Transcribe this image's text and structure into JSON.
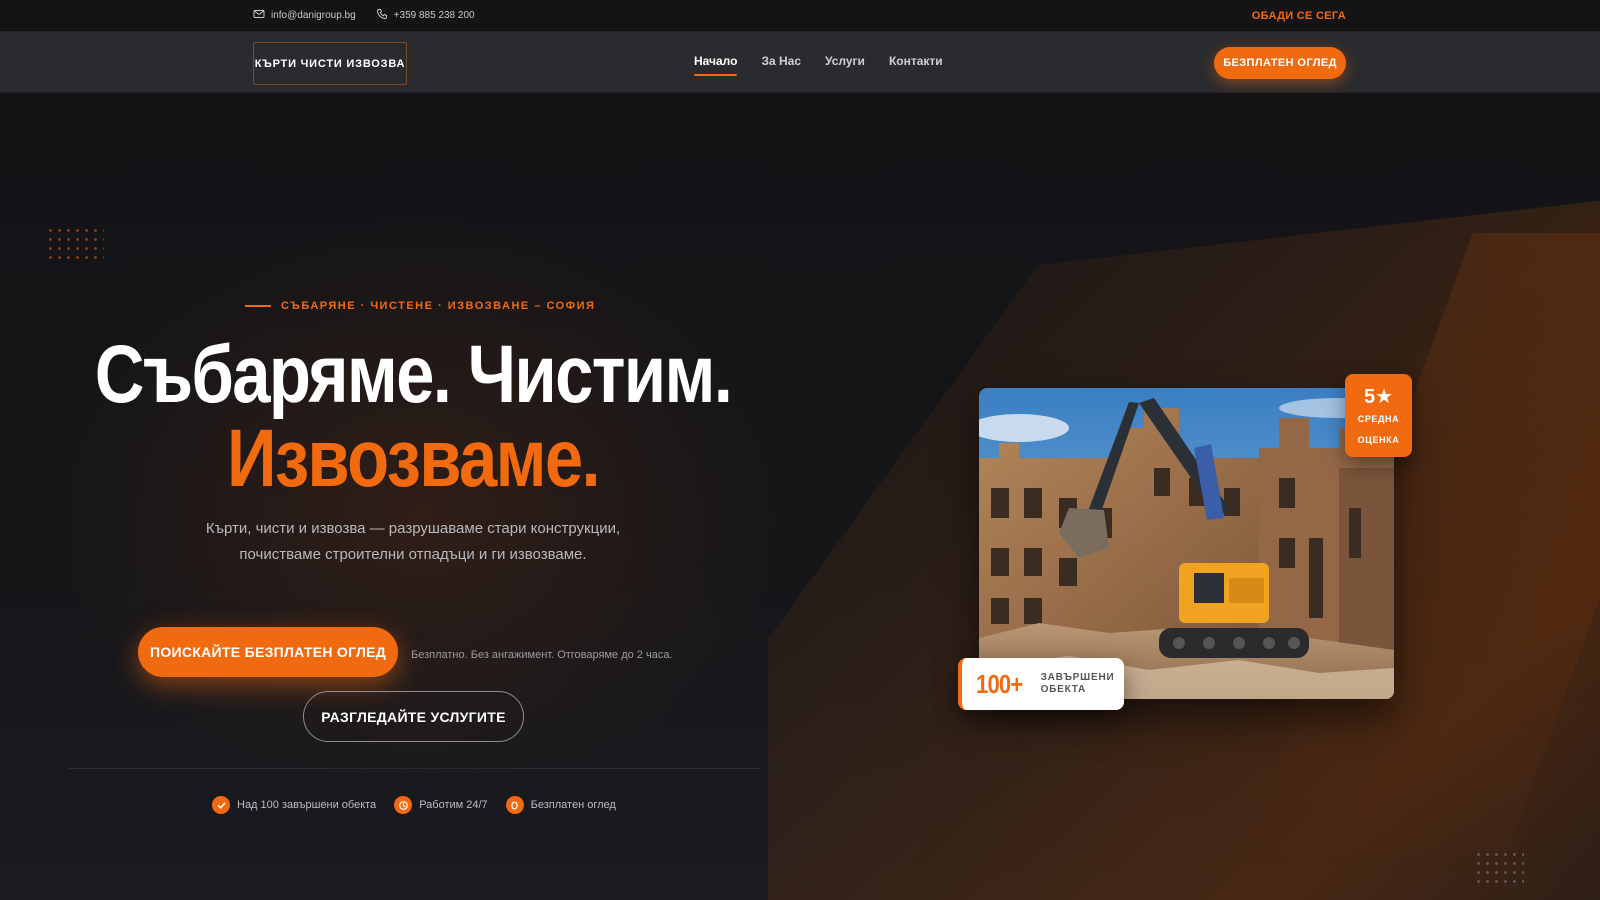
{
  "topbar": {
    "email": "info@danigroup.bg",
    "phone": "+359 885 238 200",
    "call_now": "ОБАДИ СЕ СЕГА"
  },
  "nav": {
    "logo": "КЪРТИ ЧИСТИ ИЗВОЗВА",
    "links": [
      "Начало",
      "За Нас",
      "Услуги",
      "Контакти"
    ],
    "active": "Начало",
    "cta": "БЕЗПЛАТЕН ОГЛЕД"
  },
  "hero": {
    "eyebrow": "СЪБАРЯНЕ · ЧИСТЕНЕ · ИЗВОЗВАНЕ – СОФИЯ",
    "title_line1": "Събаряме. Чистим.",
    "title_line2": "Извозваме.",
    "lead": "Кърти, чисти и извозва — разрушаваме стари конструкции, почистваме строителни отпадъци и ги извозваме.",
    "primary_button": "ПОИСКАЙТЕ БЕЗПЛАТЕН ОГЛЕД",
    "primary_note": "Безплатно. Без ангажимент. Отговаряме до 2 часа.",
    "secondary_button": "РАЗГЛЕДАЙТЕ УСЛУГИТЕ",
    "features": [
      {
        "icon": "check-icon",
        "label": "Над 100 завършени обекта"
      },
      {
        "icon": "clock-icon",
        "label": "Работим 24/7"
      },
      {
        "icon": "circle-icon",
        "label": "Безплатен оглед"
      }
    ],
    "rating": {
      "value": "5★",
      "label_line1": "СРЕДНА",
      "label_line2": "ОЦЕНКА"
    },
    "stat": {
      "value": "100+",
      "label_line1": "ЗАВЪРШЕНИ",
      "label_line2": "ОБЕКТА"
    }
  },
  "colors": {
    "accent": "#f26a0f",
    "background": "#121215",
    "nav": "#2a2b2e"
  }
}
